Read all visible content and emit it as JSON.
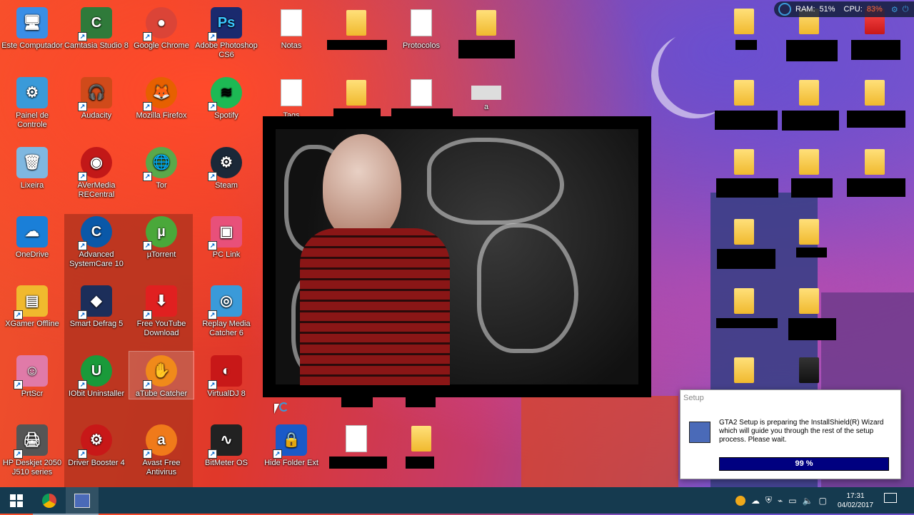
{
  "desktop": {
    "icons": [
      {
        "label": "Este Computador",
        "glyph": "🖥",
        "color": "#3a8ee6"
      },
      {
        "label": "Camtasia Studio 8",
        "glyph": "C",
        "color": "#2f7a3a"
      },
      {
        "label": "Google Chrome",
        "glyph": "●",
        "color": "#db4437"
      },
      {
        "label": "Adobe Photoshop CS6",
        "glyph": "Ps",
        "color": "#1a2a6e"
      },
      {
        "label": "Notas",
        "glyph": "",
        "color": "#ffffff"
      },
      {
        "label": "Protocolos",
        "glyph": "",
        "color": "#ffffff"
      },
      {
        "label": "Painel de Controle",
        "glyph": "⚙",
        "color": "#3a9ad9"
      },
      {
        "label": "Audacity",
        "glyph": "🎧",
        "color": "#d04a1a"
      },
      {
        "label": "Mozilla Firefox",
        "glyph": "🦊",
        "color": "#e66000"
      },
      {
        "label": "Spotify",
        "glyph": "≋",
        "color": "#1db954"
      },
      {
        "label": "Tags",
        "glyph": "",
        "color": "#ffffff"
      },
      {
        "label": "Lixeira",
        "glyph": "🗑",
        "color": "#7fb7e0"
      },
      {
        "label": "AVerMedia RECentral",
        "glyph": "◉",
        "color": "#c21818"
      },
      {
        "label": "Tor",
        "glyph": "🌐",
        "color": "#5aa84a"
      },
      {
        "label": "Steam",
        "glyph": "⚙",
        "color": "#1b2838"
      },
      {
        "label": "OneDrive",
        "glyph": "☁",
        "color": "#1a7fd8"
      },
      {
        "label": "Advanced SystemCare 10",
        "glyph": "C",
        "color": "#0a58a8"
      },
      {
        "label": "µTorrent",
        "glyph": "µ",
        "color": "#4aa83a"
      },
      {
        "label": "PC Link",
        "glyph": "▣",
        "color": "#e8507a"
      },
      {
        "label": "XGamer Offline",
        "glyph": "▤",
        "color": "#f0b92e"
      },
      {
        "label": "Smart Defrag 5",
        "glyph": "◆",
        "color": "#1c2e5a"
      },
      {
        "label": "Free YouTube Download",
        "glyph": "⬇",
        "color": "#e02020"
      },
      {
        "label": "Replay Media Catcher 6",
        "glyph": "◎",
        "color": "#3a9ad9"
      },
      {
        "label": "PrtScr",
        "glyph": "☺",
        "color": "#e07aa8"
      },
      {
        "label": "IObit Uninstaller",
        "glyph": "U",
        "color": "#1a9a3a"
      },
      {
        "label": "aTube Catcher",
        "glyph": "✋",
        "color": "#f08a1a"
      },
      {
        "label": "VirtualDJ 8",
        "glyph": "◐",
        "color": "#c81818"
      },
      {
        "label": "HP Deskjet 2050 J510 series",
        "glyph": "🖨",
        "color": "#555555"
      },
      {
        "label": "Driver Booster 4",
        "glyph": "⚙",
        "color": "#c81818"
      },
      {
        "label": "Avast Free Antivirus",
        "glyph": "a",
        "color": "#f07a1a"
      },
      {
        "label": "BitMeter OS",
        "glyph": "∿",
        "color": "#222222"
      },
      {
        "label": "Hide Folder Ext",
        "glyph": "🔒",
        "color": "#1a5ac8"
      },
      {
        "label": "a",
        "glyph": "",
        "color": "#dddddd"
      }
    ]
  },
  "perf_meter": {
    "ram_label": "RAM:",
    "ram_value": "51%",
    "cpu_label": "CPU:",
    "cpu_value": "83%",
    "ram_color": "#ffffff",
    "cpu_color": "#ff6a3a"
  },
  "setup_dialog": {
    "title": "Setup",
    "message": "GTA2 Setup is preparing the InstallShield(R) Wizard which will guide you through the rest of the setup process.  Please wait.",
    "progress_fraction": 0.99,
    "progress_label": "99 %"
  },
  "taskbar": {
    "start_icon": "windows-logo-icon",
    "pinned": [
      "chrome-icon",
      "setup-app-icon"
    ],
    "tray_icons": [
      "avast-icon",
      "cloud-icon",
      "shield-icon",
      "usb-icon",
      "network-icon",
      "speaker-icon",
      "message-icon"
    ],
    "time": "17:31",
    "date": "04/02/2017"
  }
}
